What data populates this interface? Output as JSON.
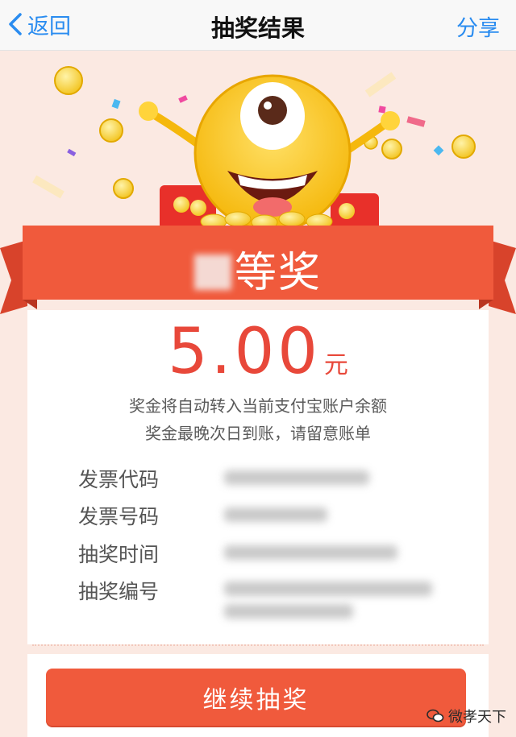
{
  "nav": {
    "back_label": "返回",
    "title": "抽奖结果",
    "share_label": "分享"
  },
  "prize": {
    "title_suffix": "等奖",
    "amount": "5.00",
    "unit": "元",
    "note_line1": "奖金将自动转入当前支付宝账户余额",
    "note_line2": "奖金最晚次日到账，请留意账单"
  },
  "info": {
    "rows": [
      {
        "label": "发票代码"
      },
      {
        "label": "发票号码"
      },
      {
        "label": "抽奖时间"
      },
      {
        "label": "抽奖编号"
      }
    ]
  },
  "action": {
    "continue_label": "继续抽奖"
  },
  "watermark": {
    "text": "微孝天下"
  },
  "colors": {
    "nav_link": "#2a8cf0",
    "ribbon": "#f05a3c",
    "amount": "#e8483a",
    "background": "#fbe9e2"
  }
}
